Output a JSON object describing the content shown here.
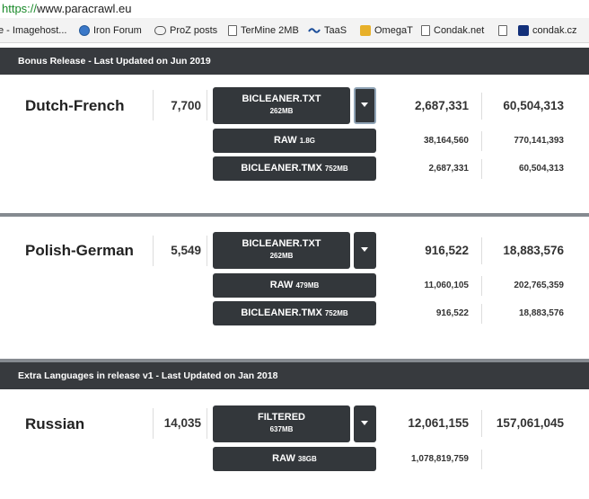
{
  "browser": {
    "url_scheme": "https://",
    "url_host": "www.paracrawl.eu",
    "bookmarks": [
      {
        "label": "e - Imagehost...",
        "icon": "document-icon"
      },
      {
        "label": "Iron Forum",
        "icon": "globe-icon"
      },
      {
        "label": "ProZ posts",
        "icon": "chat-icon"
      },
      {
        "label": "TerMine 2MB",
        "icon": "document-icon"
      },
      {
        "label": "TaaS",
        "icon": "wave-icon"
      },
      {
        "label": "OmegaT",
        "icon": "omegat-icon"
      },
      {
        "label": "Condak.net",
        "icon": "document-icon"
      },
      {
        "label": "",
        "icon": "document-icon"
      },
      {
        "label": "condak.cz",
        "icon": "condak-icon"
      }
    ]
  },
  "sections": [
    {
      "title": "Bonus Release - Last Updated on Jun 2019",
      "languages": [
        {
          "name": "Dutch-French",
          "count": "7,700",
          "main": {
            "label": "BICLEANER.TXT",
            "size": "262MB"
          },
          "main_stats": [
            "2,687,331",
            "60,504,313"
          ],
          "subs": [
            {
              "label": "RAW",
              "size": "1.8G",
              "stats": [
                "38,164,560",
                "770,141,393"
              ]
            },
            {
              "label": "BICLEANER.TMX",
              "size": "752MB",
              "stats": [
                "2,687,331",
                "60,504,313"
              ]
            }
          ]
        },
        {
          "name": "Polish-German",
          "count": "5,549",
          "main": {
            "label": "BICLEANER.TXT",
            "size": "262MB"
          },
          "main_stats": [
            "916,522",
            "18,883,576"
          ],
          "subs": [
            {
              "label": "RAW",
              "size": "479MB",
              "stats": [
                "11,060,105",
                "202,765,359"
              ]
            },
            {
              "label": "BICLEANER.TMX",
              "size": "752MB",
              "stats": [
                "916,522",
                "18,883,576"
              ]
            }
          ]
        }
      ]
    },
    {
      "title": "Extra Languages in release v1 - Last Updated on Jan 2018",
      "languages": [
        {
          "name": "Russian",
          "count": "14,035",
          "main": {
            "label": "FILTERED",
            "size": "637MB"
          },
          "main_stats": [
            "12,061,155",
            "157,061,045"
          ],
          "subs": [
            {
              "label": "RAW",
              "size": "38GB",
              "stats": [
                "1,078,819,759",
                ""
              ]
            }
          ]
        }
      ]
    }
  ],
  "colors": {
    "section_bar": "#373a3e",
    "button": "#33373b",
    "url_scheme": "#1a8a2a"
  }
}
